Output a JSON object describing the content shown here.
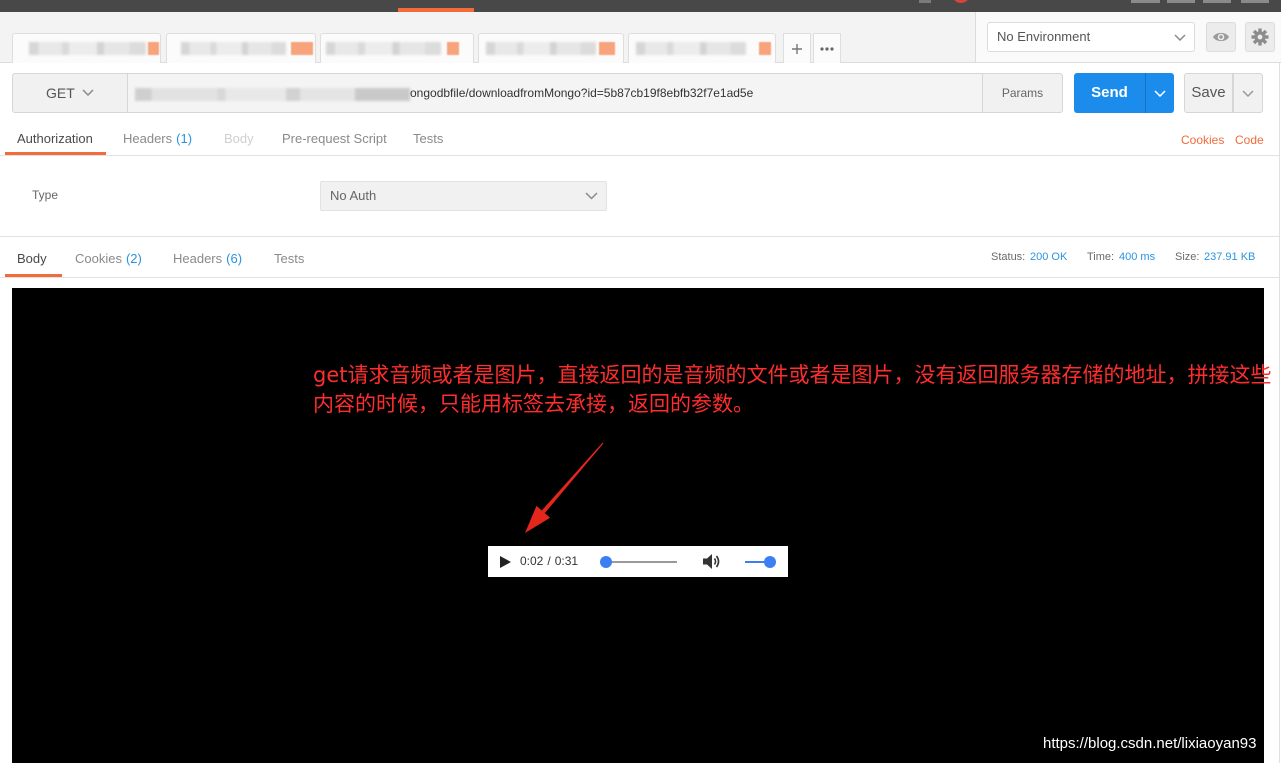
{
  "environment": {
    "selected": "No Environment",
    "quick_look_icon": "eye-icon",
    "settings_icon": "gear-icon"
  },
  "request": {
    "method": "GET",
    "url_visible": "ongodbfile/downloadfromMongo?id=5b87cb19f8ebfb32f7e1ad5e",
    "params_label": "Params",
    "send_label": "Send",
    "save_label": "Save",
    "tabs": [
      {
        "label": "Authorization",
        "active": true
      },
      {
        "label": "Headers",
        "count": "(1)"
      },
      {
        "label": "Body",
        "disabled": true
      },
      {
        "label": "Pre-request Script"
      },
      {
        "label": "Tests"
      }
    ],
    "links": {
      "cookies": "Cookies",
      "code": "Code"
    }
  },
  "auth": {
    "type_label": "Type",
    "type_value": "No Auth"
  },
  "response": {
    "tabs": [
      {
        "label": "Body",
        "active": true
      },
      {
        "label": "Cookies",
        "count": "(2)"
      },
      {
        "label": "Headers",
        "count": "(6)"
      },
      {
        "label": "Tests"
      }
    ],
    "status": {
      "label": "Status:",
      "value": "200 OK"
    },
    "time": {
      "label": "Time:",
      "value": "400 ms"
    },
    "size": {
      "label": "Size:",
      "value": "237.91 KB"
    }
  },
  "audio_player": {
    "current_time": "0:02",
    "separator": "/",
    "duration": "0:31",
    "progress": 0.06,
    "volume": 1.0
  },
  "annotation": {
    "lines": [
      "get请求音频或者是图片，直接返回的是音频的文件或者是图片，没有返回服务器存储的地址，拼接这些",
      "内容的时候，只能用标签去承接，返回的参数。"
    ]
  },
  "watermark": "https://blog.csdn.net/lixiaoyan93",
  "colors": {
    "accent_orange": "#f26b3a",
    "send_blue": "#1b8ceb",
    "count_blue": "#2a93e0",
    "annotation_red": "#ff2d2d",
    "arrow_red": "#e5261d",
    "slider_blue": "#3c7ff4"
  }
}
